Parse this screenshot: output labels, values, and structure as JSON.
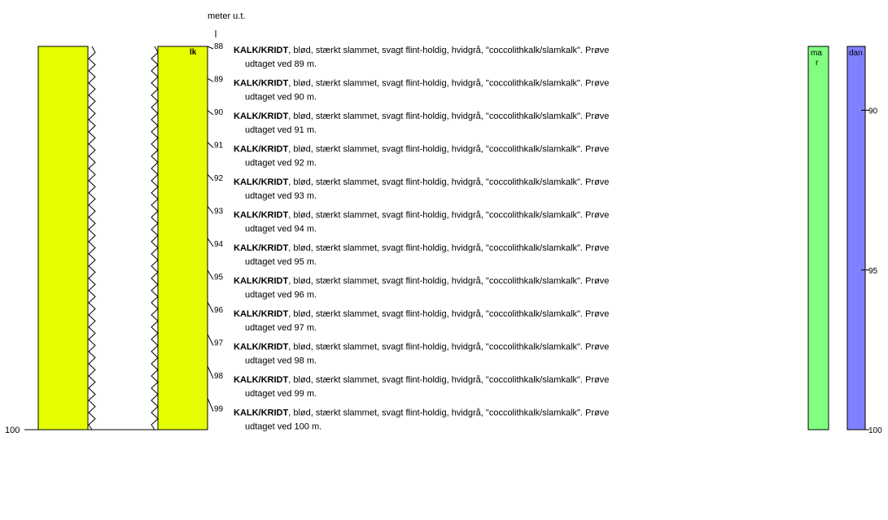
{
  "header": {
    "depth_unit": "meter u.t."
  },
  "lithology": {
    "code": "lk",
    "color": "#e6ff00",
    "bottom_label": "100"
  },
  "age_column": {
    "label": "ma\nr",
    "color": "#80ff80"
  },
  "formation_column": {
    "label": "dan",
    "color": "#8080ff",
    "scale": [
      {
        "depth": 90,
        "label": "90"
      },
      {
        "depth": 95,
        "label": "95"
      },
      {
        "depth": 100,
        "label": "100"
      }
    ]
  },
  "samples": [
    {
      "depth": "88",
      "title": "KALK/KRIDT",
      "line1": ", blød, stærkt slammet, svagt flint-holdig, hvidgrå, \"coccolithkalk/slamkalk\". Prøve",
      "line2": "udtaget ved 89 m."
    },
    {
      "depth": "89",
      "title": "KALK/KRIDT",
      "line1": ", blød, stærkt slammet, svagt flint-holdig, hvidgrå, \"coccolithkalk/slamkalk\". Prøve",
      "line2": "udtaget ved 90 m."
    },
    {
      "depth": "90",
      "title": "KALK/KRIDT",
      "line1": ", blød, stærkt slammet, svagt flint-holdig, hvidgrå, \"coccolithkalk/slamkalk\". Prøve",
      "line2": "udtaget ved 91 m."
    },
    {
      "depth": "91",
      "title": "KALK/KRIDT",
      "line1": ", blød, stærkt slammet, svagt flint-holdig, hvidgrå, \"coccolithkalk/slamkalk\". Prøve",
      "line2": "udtaget ved 92 m."
    },
    {
      "depth": "92",
      "title": "KALK/KRIDT",
      "line1": ", blød, stærkt slammet, svagt flint-holdig, hvidgrå, \"coccolithkalk/slamkalk\". Prøve",
      "line2": "udtaget ved 93 m."
    },
    {
      "depth": "93",
      "title": "KALK/KRIDT",
      "line1": ", blød, stærkt slammet, svagt flint-holdig, hvidgrå, \"coccolithkalk/slamkalk\". Prøve",
      "line2": "udtaget ved 94 m."
    },
    {
      "depth": "94",
      "title": "KALK/KRIDT",
      "line1": ", blød, stærkt slammet, svagt flint-holdig, hvidgrå, \"coccolithkalk/slamkalk\". Prøve",
      "line2": "udtaget ved 95 m."
    },
    {
      "depth": "95",
      "title": "KALK/KRIDT",
      "line1": ", blød, stærkt slammet, svagt flint-holdig, hvidgrå, \"coccolithkalk/slamkalk\". Prøve",
      "line2": "udtaget ved 96 m."
    },
    {
      "depth": "96",
      "title": "KALK/KRIDT",
      "line1": ", blød, stærkt slammet, svagt flint-holdig, hvidgrå, \"coccolithkalk/slamkalk\". Prøve",
      "line2": "udtaget ved 97 m."
    },
    {
      "depth": "97",
      "title": "KALK/KRIDT",
      "line1": ", blød, stærkt slammet, svagt flint-holdig, hvidgrå, \"coccolithkalk/slamkalk\". Prøve",
      "line2": "udtaget ved 98 m."
    },
    {
      "depth": "98",
      "title": "KALK/KRIDT",
      "line1": ", blød, stærkt slammet, svagt flint-holdig, hvidgrå, \"coccolithkalk/slamkalk\". Prøve",
      "line2": "udtaget ved 99 m."
    },
    {
      "depth": "99",
      "title": "KALK/KRIDT",
      "line1": ", blød, stærkt slammet, svagt flint-holdig, hvidgrå, \"coccolithkalk/slamkalk\". Prøve",
      "line2": "udtaget ved 100 m."
    }
  ]
}
